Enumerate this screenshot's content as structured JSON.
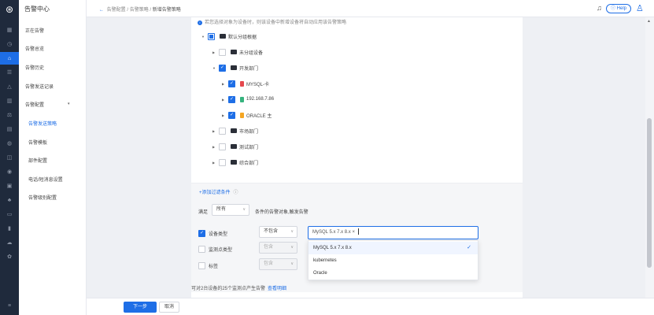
{
  "app": {
    "title": "告警中心"
  },
  "rail": {
    "icons": [
      "menu-icon",
      "clock-icon",
      "alert-icon",
      "list-icon",
      "bell-icon",
      "chart-icon",
      "scale-icon",
      "grid-icon",
      "globe-icon",
      "box-icon",
      "target-icon",
      "image-icon",
      "group-icon",
      "monitor-icon",
      "bar-icon",
      "cloud-icon",
      "gear-icon",
      "menu-bottom-icon"
    ]
  },
  "nav": {
    "items": [
      {
        "label": "正在告警"
      },
      {
        "label": "告警总览"
      },
      {
        "label": "告警历史"
      },
      {
        "label": "告警发送记录"
      },
      {
        "label": "告警配置"
      },
      {
        "label": "告警发送策略"
      },
      {
        "label": "告警模板"
      },
      {
        "label": "部件配置"
      },
      {
        "label": "电话/短消息设置"
      },
      {
        "label": "告警级别配置"
      }
    ]
  },
  "header": {
    "breadcrumb": [
      "告警配置",
      "告警策略",
      "新增告警策略"
    ],
    "help_label": "Help"
  },
  "tree": {
    "hint": "若您选择对象为设备时，则该设备中新增设备将自动应用该告警策略",
    "nodes": [
      {
        "label": "默认分组根据"
      },
      {
        "label": "未分组设备"
      },
      {
        "label": "开发部门"
      },
      {
        "label": "MYSQL-卡"
      },
      {
        "label": "192.168.7.86"
      },
      {
        "label": "ORACLE 主"
      },
      {
        "label": "市场部门"
      },
      {
        "label": "测试部门"
      },
      {
        "label": "综合部门"
      }
    ]
  },
  "conditions": {
    "add_label": "+添加过滤条件",
    "satisfy_prefix": "满足",
    "satisfy_value": "所有",
    "satisfy_suffix": "条件的告警对象,触发告警",
    "rows": [
      {
        "label": "设备类型",
        "op": "不包含"
      },
      {
        "label": "监测点类型",
        "op": "包含"
      },
      {
        "label": "标签",
        "op": "包含"
      }
    ],
    "tag_input_value": "MySQL 5.x 7.x 8.x ×",
    "dropdown": [
      {
        "label": "MySQL 5.x 7.x 8.x"
      },
      {
        "label": "kubernetes"
      },
      {
        "label": "Oracle"
      }
    ],
    "summary": "可对2台设备的25个监测点产生告警",
    "summary_link": "查看明细"
  },
  "footer": {
    "next_label": "下一步",
    "cancel_label": "取消"
  },
  "colors": {
    "accent": "#1e6ee6",
    "rail_bg": "#1f2a3c"
  }
}
